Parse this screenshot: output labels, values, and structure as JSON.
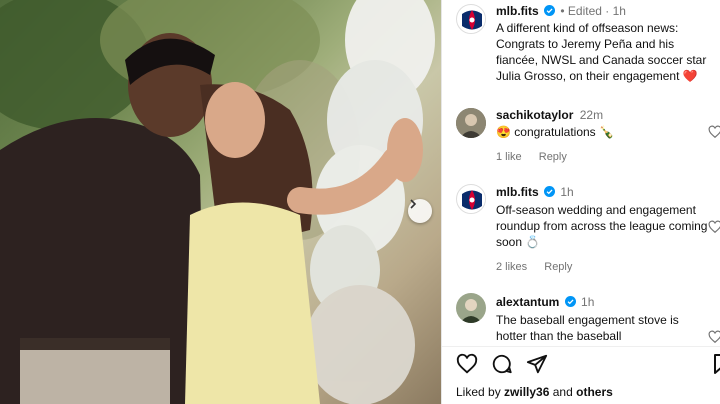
{
  "post": {
    "author": "mlb.fits",
    "edited_label": "Edited",
    "time": "1h",
    "caption": "A different kind of offseason news: Congrats to Jeremy Peña and his fiancée, NWSL and Canada soccer star Julia Grosso, on their engagement ❤️"
  },
  "comments": [
    {
      "user": "sachikotaylor",
      "time": "22m",
      "text": "😍 congratulations 🍾",
      "likes": "1 like",
      "reply": "Reply",
      "verified": false
    },
    {
      "user": "mlb.fits",
      "time": "1h",
      "text": "Off-season wedding and engagement roundup from across the league coming soon 💍",
      "likes": "2 likes",
      "reply": "Reply",
      "verified": true
    },
    {
      "user": "alextantum",
      "time": "1h",
      "text": "The baseball engagement stove is hotter than the baseball",
      "verified": true
    }
  ],
  "footer": {
    "liked_by_prefix": "Liked by",
    "liked_by_user": "zwilly36",
    "liked_by_and": "and",
    "liked_by_others": "others"
  },
  "colors": {
    "verified": "#0095f6",
    "heart": "#ed4956",
    "meta": "#737373"
  },
  "icons": [
    "heart-icon",
    "comment-icon",
    "share-icon",
    "bookmark-icon",
    "verified-icon",
    "chevron-right-icon"
  ]
}
